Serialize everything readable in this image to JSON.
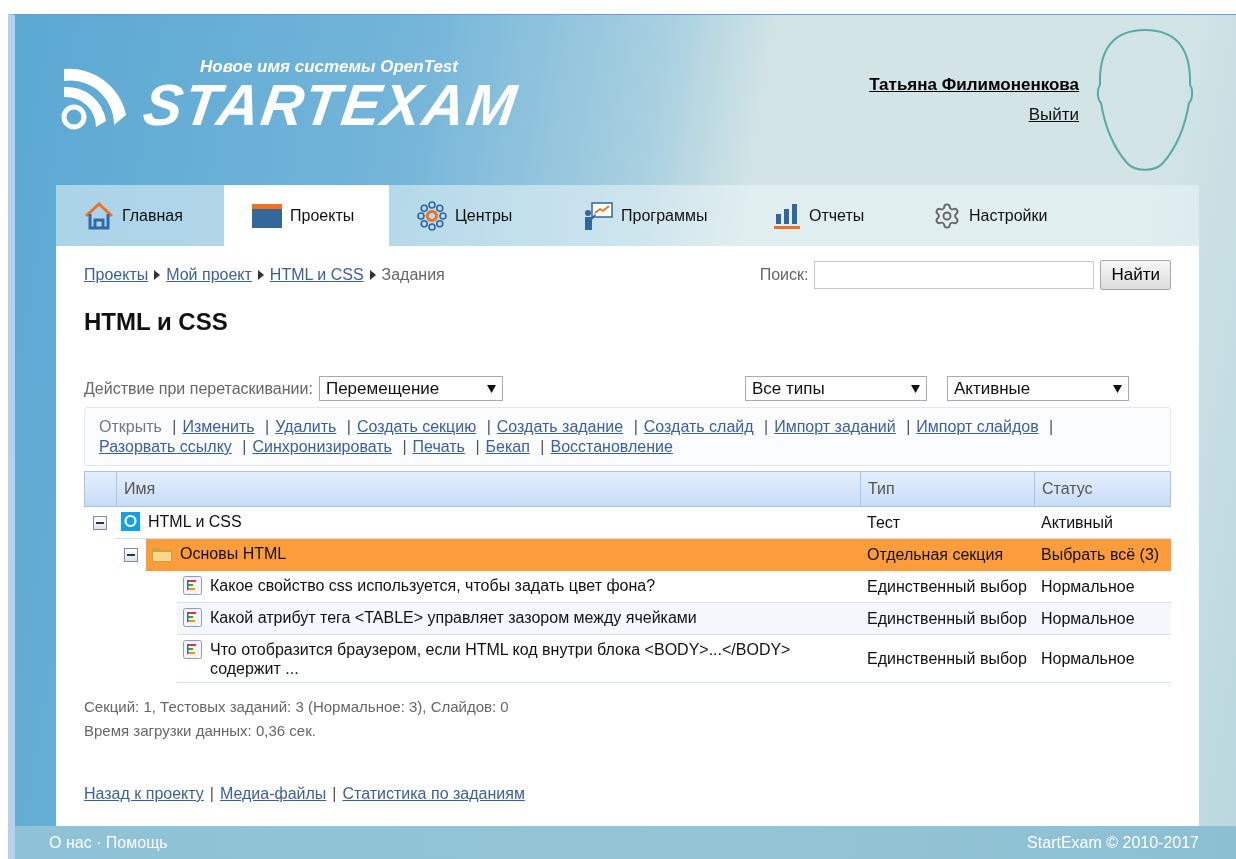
{
  "header": {
    "tagline": "Новое имя системы OpenTest",
    "logo": "STARTEXAM",
    "user": "Татьяна Филимоненкова",
    "logout": "Выйти"
  },
  "tabs": [
    {
      "label": "Главная",
      "kind": "home",
      "selected": false
    },
    {
      "label": "Проекты",
      "kind": "projects",
      "selected": true
    },
    {
      "label": "Центры",
      "kind": "centers",
      "selected": false
    },
    {
      "label": "Программы",
      "kind": "programs",
      "selected": false
    },
    {
      "label": "Отчеты",
      "kind": "reports",
      "selected": false
    },
    {
      "label": "Настройки",
      "kind": "settings",
      "selected": false
    }
  ],
  "breadcrumb": {
    "links": [
      "Проекты",
      "Мой проект",
      "HTML и CSS"
    ],
    "current": "Задания"
  },
  "search": {
    "label": "Поиск:",
    "button": "Найти"
  },
  "title": "HTML и CSS",
  "drag_action": {
    "label": "Действие при перетаскивании:",
    "value": "Перемещение"
  },
  "filters": [
    {
      "value": "Все типы"
    },
    {
      "value": "Активные"
    }
  ],
  "actions": {
    "separator": "|",
    "items": [
      {
        "label": "Открыть",
        "disabled": true
      },
      {
        "label": "Изменить",
        "disabled": false
      },
      {
        "label": "Удалить",
        "disabled": false
      },
      {
        "label": "Создать секцию",
        "disabled": false
      },
      {
        "label": "Создать задание",
        "disabled": false
      },
      {
        "label": "Создать слайд",
        "disabled": false
      },
      {
        "label": "Импорт заданий",
        "disabled": false
      },
      {
        "label": "Импорт слайдов",
        "disabled": false
      },
      {
        "label": "Разорвать ссылку",
        "disabled": false
      },
      {
        "label": "Синхронизировать",
        "disabled": false
      },
      {
        "label": "Печать",
        "disabled": false
      },
      {
        "label": "Бекап",
        "disabled": false
      },
      {
        "label": "Восстановление",
        "disabled": false
      }
    ]
  },
  "table": {
    "columns": [
      "Имя",
      "Тип",
      "Статус"
    ],
    "rows": [
      {
        "kind": "test",
        "name": "HTML и CSS",
        "type": "Тест",
        "status": "Активный",
        "expanded": true,
        "selected": false,
        "children": [
          {
            "kind": "section",
            "name": "Основы HTML",
            "type": "Отдельная секция",
            "status": "Выбрать всё (3)",
            "expanded": true,
            "selected": true,
            "children": [
              {
                "kind": "question",
                "name": "Какое свойство css используется, чтобы задать цвет фона?",
                "type": "Единственный выбор",
                "status": "Нормальное",
                "selected": false
              },
              {
                "kind": "question",
                "name": "Какой атрибут тега <TABLE> управляет зазором между ячейками",
                "type": "Единственный выбор",
                "status": "Нормальное",
                "selected": false
              },
              {
                "kind": "question",
                "name": "Что отобразится браузером, если HTML код внутри блока <BODY>...</BODY> содержит ...",
                "type": "Единственный выбор",
                "status": "Нормальное",
                "selected": false
              }
            ]
          }
        ]
      }
    ]
  },
  "stats": [
    "Секций: 1, Тестовых заданий: 3 (Нормальное: 3), Слайдов: 0",
    "Время загрузки данных: 0,36 сек."
  ],
  "bottom_links": {
    "separator": "|",
    "items": [
      "Назад к проекту",
      "Медиа-файлы",
      "Статистика по заданиям"
    ]
  },
  "footer": {
    "links": [
      "О нас",
      "Помощь"
    ],
    "separator": "·",
    "copyright": "StartExam © 2010-2017"
  }
}
